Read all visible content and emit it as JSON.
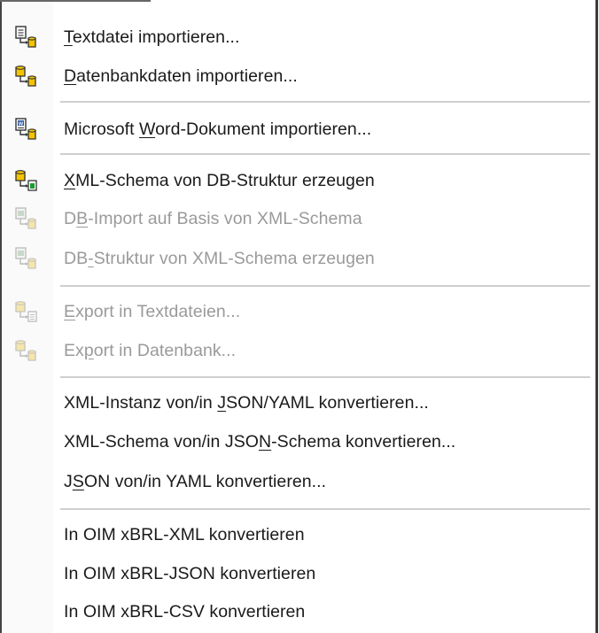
{
  "menu": {
    "items": [
      {
        "id": "textdatei",
        "label": "Textdatei importieren...",
        "mnemonic": "T",
        "enabled": true,
        "icon": "import-text-icon"
      },
      {
        "id": "datenbankdaten",
        "label": "Datenbankdaten importieren...",
        "mnemonic": "D",
        "enabled": true,
        "icon": "import-database-icon"
      },
      {
        "id": "word",
        "label": "Microsoft Word-Dokument importieren...",
        "mnemonic": "W",
        "enabled": true,
        "icon": "import-word-icon"
      },
      {
        "id": "xml-schema-db",
        "label": "XML-Schema von DB-Struktur erzeugen",
        "mnemonic": "X",
        "enabled": true,
        "icon": "schema-from-db-icon"
      },
      {
        "id": "db-import",
        "label": "DB-Import auf Basis von XML-Schema",
        "mnemonic": "B",
        "enabled": false,
        "icon": "db-import-schema-icon"
      },
      {
        "id": "db-struktur",
        "label": "DB-Struktur von XML-Schema erzeugen",
        "mnemonic": "-",
        "enabled": false,
        "icon": "db-structure-icon"
      },
      {
        "id": "export-text",
        "label": "Export in Textdateien...",
        "mnemonic": "E",
        "enabled": false,
        "icon": "export-text-icon"
      },
      {
        "id": "export-db",
        "label": "Export in Datenbank...",
        "mnemonic": "p",
        "enabled": false,
        "icon": "export-database-icon"
      },
      {
        "id": "json-yaml",
        "label": "XML-Instanz von/in JSON/YAML konvertieren...",
        "mnemonic": "J",
        "enabled": true,
        "icon": ""
      },
      {
        "id": "json-schema",
        "label": "XML-Schema von/in JSON-Schema konvertieren...",
        "mnemonic": "N",
        "enabled": true,
        "icon": ""
      },
      {
        "id": "json-yaml2",
        "label": "JSON von/in YAML konvertieren...",
        "mnemonic": "S",
        "enabled": true,
        "icon": ""
      },
      {
        "id": "oim-xml",
        "label": "In OIM xBRL-XML konvertieren",
        "mnemonic": "",
        "enabled": true,
        "icon": ""
      },
      {
        "id": "oim-json",
        "label": "In OIM xBRL-JSON konvertieren",
        "mnemonic": "",
        "enabled": true,
        "icon": ""
      },
      {
        "id": "oim-csv",
        "label": "In OIM xBRL-CSV konvertieren",
        "mnemonic": "",
        "enabled": true,
        "icon": ""
      }
    ]
  },
  "colors": {
    "text": "#1a1a1a",
    "disabled_text": "#9a9a9a",
    "icon_yellow": "#f5c400",
    "icon_green": "#1a9c2e",
    "separator": "#cfcfcf"
  }
}
